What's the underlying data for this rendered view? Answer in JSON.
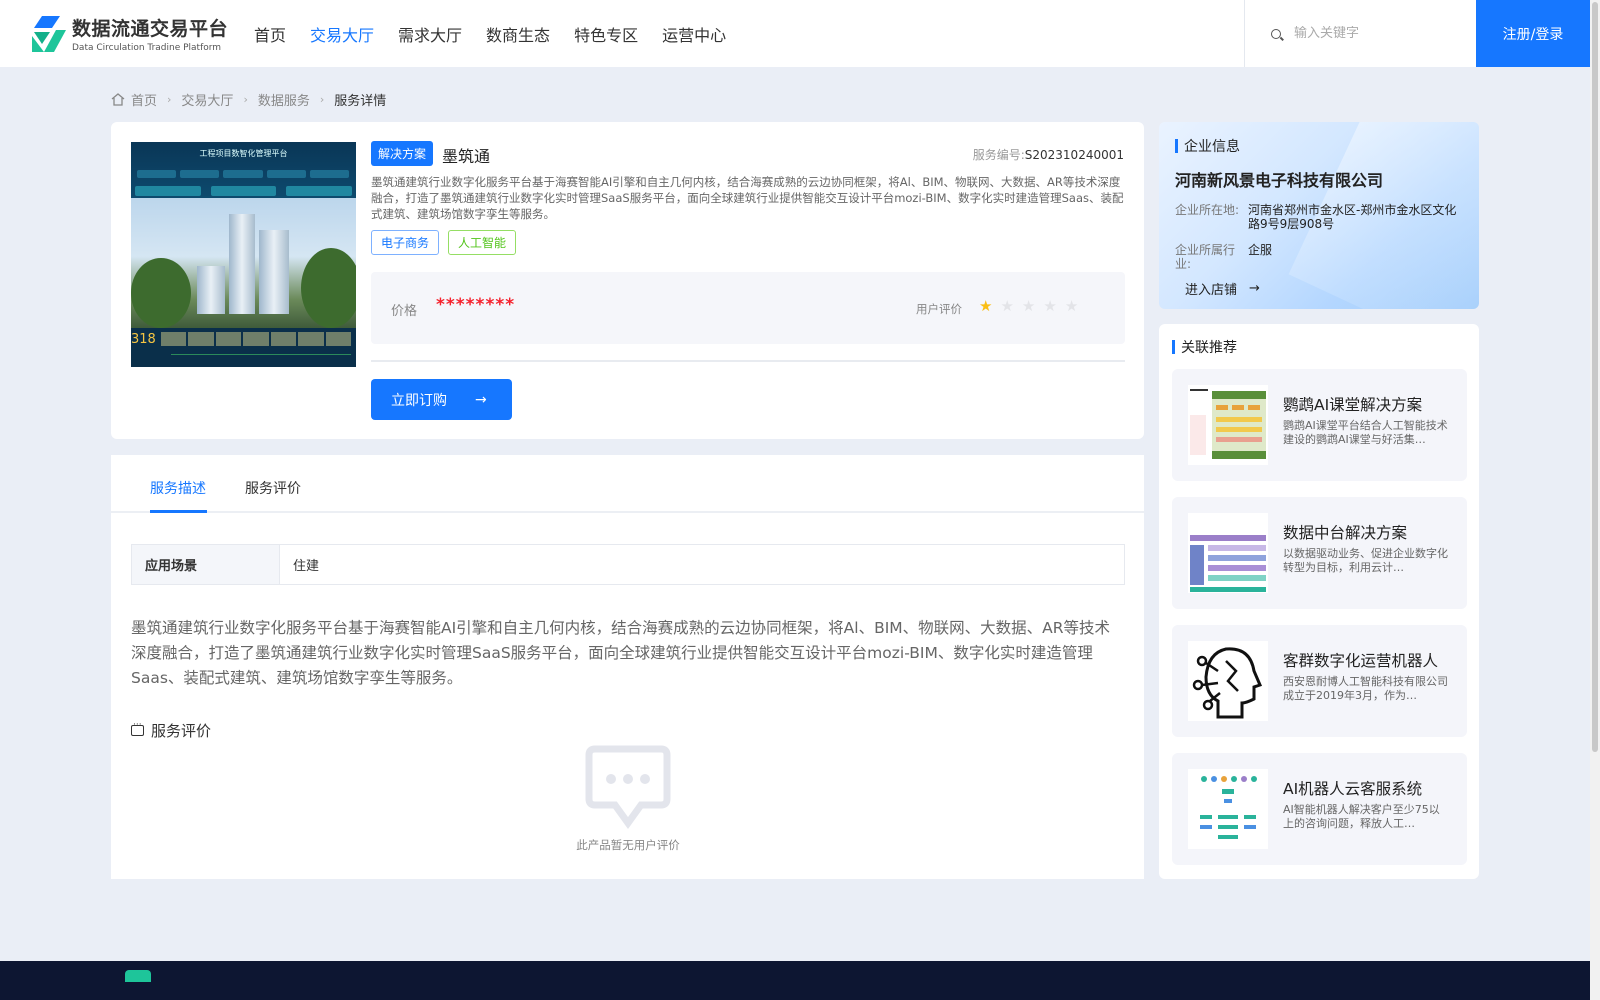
{
  "header": {
    "logo_cn": "数据流通交易平台",
    "logo_en": "Data Circulation Tradine Platform",
    "nav": [
      {
        "label": "首页",
        "active": false
      },
      {
        "label": "交易大厅",
        "active": true
      },
      {
        "label": "需求大厅",
        "active": false
      },
      {
        "label": "数商生态",
        "active": false
      },
      {
        "label": "特色专区",
        "active": false
      },
      {
        "label": "运营中心",
        "active": false
      }
    ],
    "search_placeholder": "输入关键字",
    "login_label": "注册/登录"
  },
  "breadcrumb": {
    "home": "首页",
    "items": [
      "交易大厅",
      "数据服务"
    ],
    "current": "服务详情"
  },
  "product": {
    "image_title": "工程项目数智化管理平台",
    "image_number": "318",
    "category_tag": "解决方案",
    "name": "墨筑通",
    "service_no_label": "服务编号:",
    "service_no": "S202310240001",
    "description": "墨筑通建筑行业数字化服务平台基于海赛智能AI引擎和自主几何内核，结合海赛成熟的云边协同框架，将Al、BIM、物联网、大数据、AR等技术深度融合，打造了墨筑通建筑行业数字化实时管理SaaS服务平台，面向全球建筑行业提供智能交互设计平台mozi-BIM、数字化实时建造管理Saas、装配式建筑、建筑场馆数字孪生等服务。",
    "tags": [
      "电子商务",
      "人工智能"
    ],
    "price_label": "价格",
    "price_value": "********",
    "rating_label": "用户评价",
    "rating": 1,
    "rating_max": 5,
    "order_label": "立即订购"
  },
  "details": {
    "tabs": [
      {
        "label": "服务描述",
        "active": true
      },
      {
        "label": "服务评价",
        "active": false
      }
    ],
    "scene_key": "应用场景",
    "scene_value": "住建",
    "long_description": "墨筑通建筑行业数字化服务平台基于海赛智能AI引擎和自主几何内核，结合海赛成熟的云边协同框架，将Al、BIM、物联网、大数据、AR等技术深度融合，打造了墨筑通建筑行业数字化实时管理SaaS服务平台，面向全球建筑行业提供智能交互设计平台mozi-BIM、数字化实时建造管理Saas、装配式建筑、建筑场馆数字孪生等服务。",
    "review_title": "服务评价",
    "empty_review": "此产品暂无用户评价"
  },
  "company": {
    "section_title": "企业信息",
    "name": "河南新风景电子科技有限公司",
    "location_label": "企业所在地:",
    "location": "河南省郑州市金水区-郑州市金水区文化路9号9层908号",
    "industry_label": "企业所属行业:",
    "industry": "企服",
    "store_link": "进入店铺"
  },
  "recommendations": {
    "section_title": "关联推荐",
    "items": [
      {
        "title": "鹦鹉AI课堂解决方案",
        "desc": "鹦鹉AI课堂平台结合人工智能技术建设的鹦鹉AI课堂与好活集…"
      },
      {
        "title": "数据中台解决方案",
        "desc": "以数据驱动业务、促进企业数字化转型为目标，利用云计…"
      },
      {
        "title": "客群数字化运营机器人",
        "desc": "西安恩耐博人工智能科技有限公司成立于2019年3月，作为…"
      },
      {
        "title": "AI机器人云客服系统",
        "desc": "AI智能机器人解决客户至少75以上的咨询问题，释放人工…"
      }
    ]
  },
  "colors": {
    "primary": "#1677ff",
    "price": "#f5222d",
    "tag_green": "#52c41a",
    "star": "#fabe14",
    "footer": "#0d1632"
  }
}
